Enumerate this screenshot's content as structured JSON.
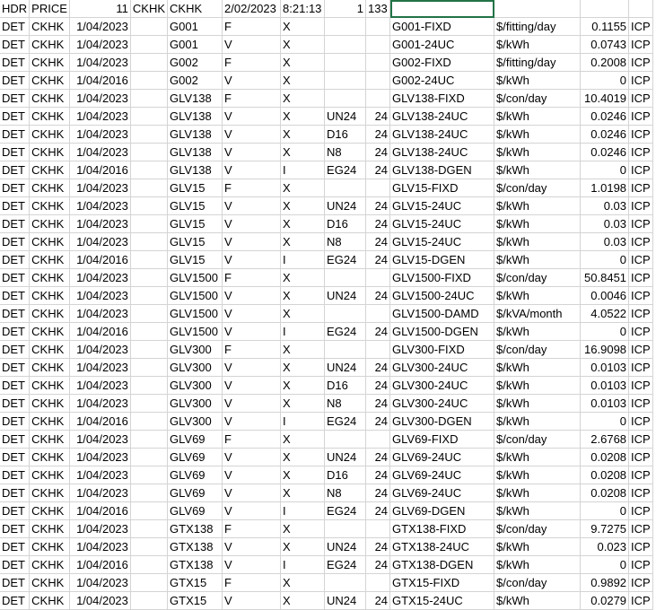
{
  "header_row": [
    "HDR",
    "PRICE",
    "11",
    "CKHK",
    "CKHK",
    "2/02/2023",
    "8:21:13",
    "1",
    "133",
    "",
    "",
    ""
  ],
  "rows": [
    [
      "DET",
      "CKHK",
      "1/04/2023",
      "G001",
      "F",
      "X",
      "",
      "",
      "G001-FIXD",
      "$/fitting/day",
      "0.1155",
      "ICP"
    ],
    [
      "DET",
      "CKHK",
      "1/04/2023",
      "G001",
      "V",
      "X",
      "",
      "",
      "G001-24UC",
      "$/kWh",
      "0.0743",
      "ICP"
    ],
    [
      "DET",
      "CKHK",
      "1/04/2023",
      "G002",
      "F",
      "X",
      "",
      "",
      "G002-FIXD",
      "$/fitting/day",
      "0.2008",
      "ICP"
    ],
    [
      "DET",
      "CKHK",
      "1/04/2016",
      "G002",
      "V",
      "X",
      "",
      "",
      "G002-24UC",
      "$/kWh",
      "0",
      "ICP"
    ],
    [
      "DET",
      "CKHK",
      "1/04/2023",
      "GLV138",
      "F",
      "X",
      "",
      "",
      "GLV138-FIXD",
      "$/con/day",
      "10.4019",
      "ICP"
    ],
    [
      "DET",
      "CKHK",
      "1/04/2023",
      "GLV138",
      "V",
      "X",
      "UN24",
      "24",
      "GLV138-24UC",
      "$/kWh",
      "0.0246",
      "ICP"
    ],
    [
      "DET",
      "CKHK",
      "1/04/2023",
      "GLV138",
      "V",
      "X",
      "D16",
      "24",
      "GLV138-24UC",
      "$/kWh",
      "0.0246",
      "ICP"
    ],
    [
      "DET",
      "CKHK",
      "1/04/2023",
      "GLV138",
      "V",
      "X",
      "N8",
      "24",
      "GLV138-24UC",
      "$/kWh",
      "0.0246",
      "ICP"
    ],
    [
      "DET",
      "CKHK",
      "1/04/2016",
      "GLV138",
      "V",
      "I",
      "EG24",
      "24",
      "GLV138-DGEN",
      "$/kWh",
      "0",
      "ICP"
    ],
    [
      "DET",
      "CKHK",
      "1/04/2023",
      "GLV15",
      "F",
      "X",
      "",
      "",
      "GLV15-FIXD",
      "$/con/day",
      "1.0198",
      "ICP"
    ],
    [
      "DET",
      "CKHK",
      "1/04/2023",
      "GLV15",
      "V",
      "X",
      "UN24",
      "24",
      "GLV15-24UC",
      "$/kWh",
      "0.03",
      "ICP"
    ],
    [
      "DET",
      "CKHK",
      "1/04/2023",
      "GLV15",
      "V",
      "X",
      "D16",
      "24",
      "GLV15-24UC",
      "$/kWh",
      "0.03",
      "ICP"
    ],
    [
      "DET",
      "CKHK",
      "1/04/2023",
      "GLV15",
      "V",
      "X",
      "N8",
      "24",
      "GLV15-24UC",
      "$/kWh",
      "0.03",
      "ICP"
    ],
    [
      "DET",
      "CKHK",
      "1/04/2016",
      "GLV15",
      "V",
      "I",
      "EG24",
      "24",
      "GLV15-DGEN",
      "$/kWh",
      "0",
      "ICP"
    ],
    [
      "DET",
      "CKHK",
      "1/04/2023",
      "GLV1500",
      "F",
      "X",
      "",
      "",
      "GLV1500-FIXD",
      "$/con/day",
      "50.8451",
      "ICP"
    ],
    [
      "DET",
      "CKHK",
      "1/04/2023",
      "GLV1500",
      "V",
      "X",
      "UN24",
      "24",
      "GLV1500-24UC",
      "$/kWh",
      "0.0046",
      "ICP"
    ],
    [
      "DET",
      "CKHK",
      "1/04/2023",
      "GLV1500",
      "V",
      "X",
      "",
      "",
      "GLV1500-DAMD",
      "$/kVA/month",
      "4.0522",
      "ICP"
    ],
    [
      "DET",
      "CKHK",
      "1/04/2016",
      "GLV1500",
      "V",
      "I",
      "EG24",
      "24",
      "GLV1500-DGEN",
      "$/kWh",
      "0",
      "ICP"
    ],
    [
      "DET",
      "CKHK",
      "1/04/2023",
      "GLV300",
      "F",
      "X",
      "",
      "",
      "GLV300-FIXD",
      "$/con/day",
      "16.9098",
      "ICP"
    ],
    [
      "DET",
      "CKHK",
      "1/04/2023",
      "GLV300",
      "V",
      "X",
      "UN24",
      "24",
      "GLV300-24UC",
      "$/kWh",
      "0.0103",
      "ICP"
    ],
    [
      "DET",
      "CKHK",
      "1/04/2023",
      "GLV300",
      "V",
      "X",
      "D16",
      "24",
      "GLV300-24UC",
      "$/kWh",
      "0.0103",
      "ICP"
    ],
    [
      "DET",
      "CKHK",
      "1/04/2023",
      "GLV300",
      "V",
      "X",
      "N8",
      "24",
      "GLV300-24UC",
      "$/kWh",
      "0.0103",
      "ICP"
    ],
    [
      "DET",
      "CKHK",
      "1/04/2016",
      "GLV300",
      "V",
      "I",
      "EG24",
      "24",
      "GLV300-DGEN",
      "$/kWh",
      "0",
      "ICP"
    ],
    [
      "DET",
      "CKHK",
      "1/04/2023",
      "GLV69",
      "F",
      "X",
      "",
      "",
      "GLV69-FIXD",
      "$/con/day",
      "2.6768",
      "ICP"
    ],
    [
      "DET",
      "CKHK",
      "1/04/2023",
      "GLV69",
      "V",
      "X",
      "UN24",
      "24",
      "GLV69-24UC",
      "$/kWh",
      "0.0208",
      "ICP"
    ],
    [
      "DET",
      "CKHK",
      "1/04/2023",
      "GLV69",
      "V",
      "X",
      "D16",
      "24",
      "GLV69-24UC",
      "$/kWh",
      "0.0208",
      "ICP"
    ],
    [
      "DET",
      "CKHK",
      "1/04/2023",
      "GLV69",
      "V",
      "X",
      "N8",
      "24",
      "GLV69-24UC",
      "$/kWh",
      "0.0208",
      "ICP"
    ],
    [
      "DET",
      "CKHK",
      "1/04/2016",
      "GLV69",
      "V",
      "I",
      "EG24",
      "24",
      "GLV69-DGEN",
      "$/kWh",
      "0",
      "ICP"
    ],
    [
      "DET",
      "CKHK",
      "1/04/2023",
      "GTX138",
      "F",
      "X",
      "",
      "",
      "GTX138-FIXD",
      "$/con/day",
      "9.7275",
      "ICP"
    ],
    [
      "DET",
      "CKHK",
      "1/04/2023",
      "GTX138",
      "V",
      "X",
      "UN24",
      "24",
      "GTX138-24UC",
      "$/kWh",
      "0.023",
      "ICP"
    ],
    [
      "DET",
      "CKHK",
      "1/04/2016",
      "GTX138",
      "V",
      "I",
      "EG24",
      "24",
      "GTX138-DGEN",
      "$/kWh",
      "0",
      "ICP"
    ],
    [
      "DET",
      "CKHK",
      "1/04/2023",
      "GTX15",
      "F",
      "X",
      "",
      "",
      "GTX15-FIXD",
      "$/con/day",
      "0.9892",
      "ICP"
    ],
    [
      "DET",
      "CKHK",
      "1/04/2023",
      "GTX15",
      "V",
      "X",
      "UN24",
      "24",
      "GTX15-24UC",
      "$/kWh",
      "0.0279",
      "ICP"
    ]
  ],
  "colors": {
    "grid": "#d4d4d4",
    "selection": "#217346"
  }
}
